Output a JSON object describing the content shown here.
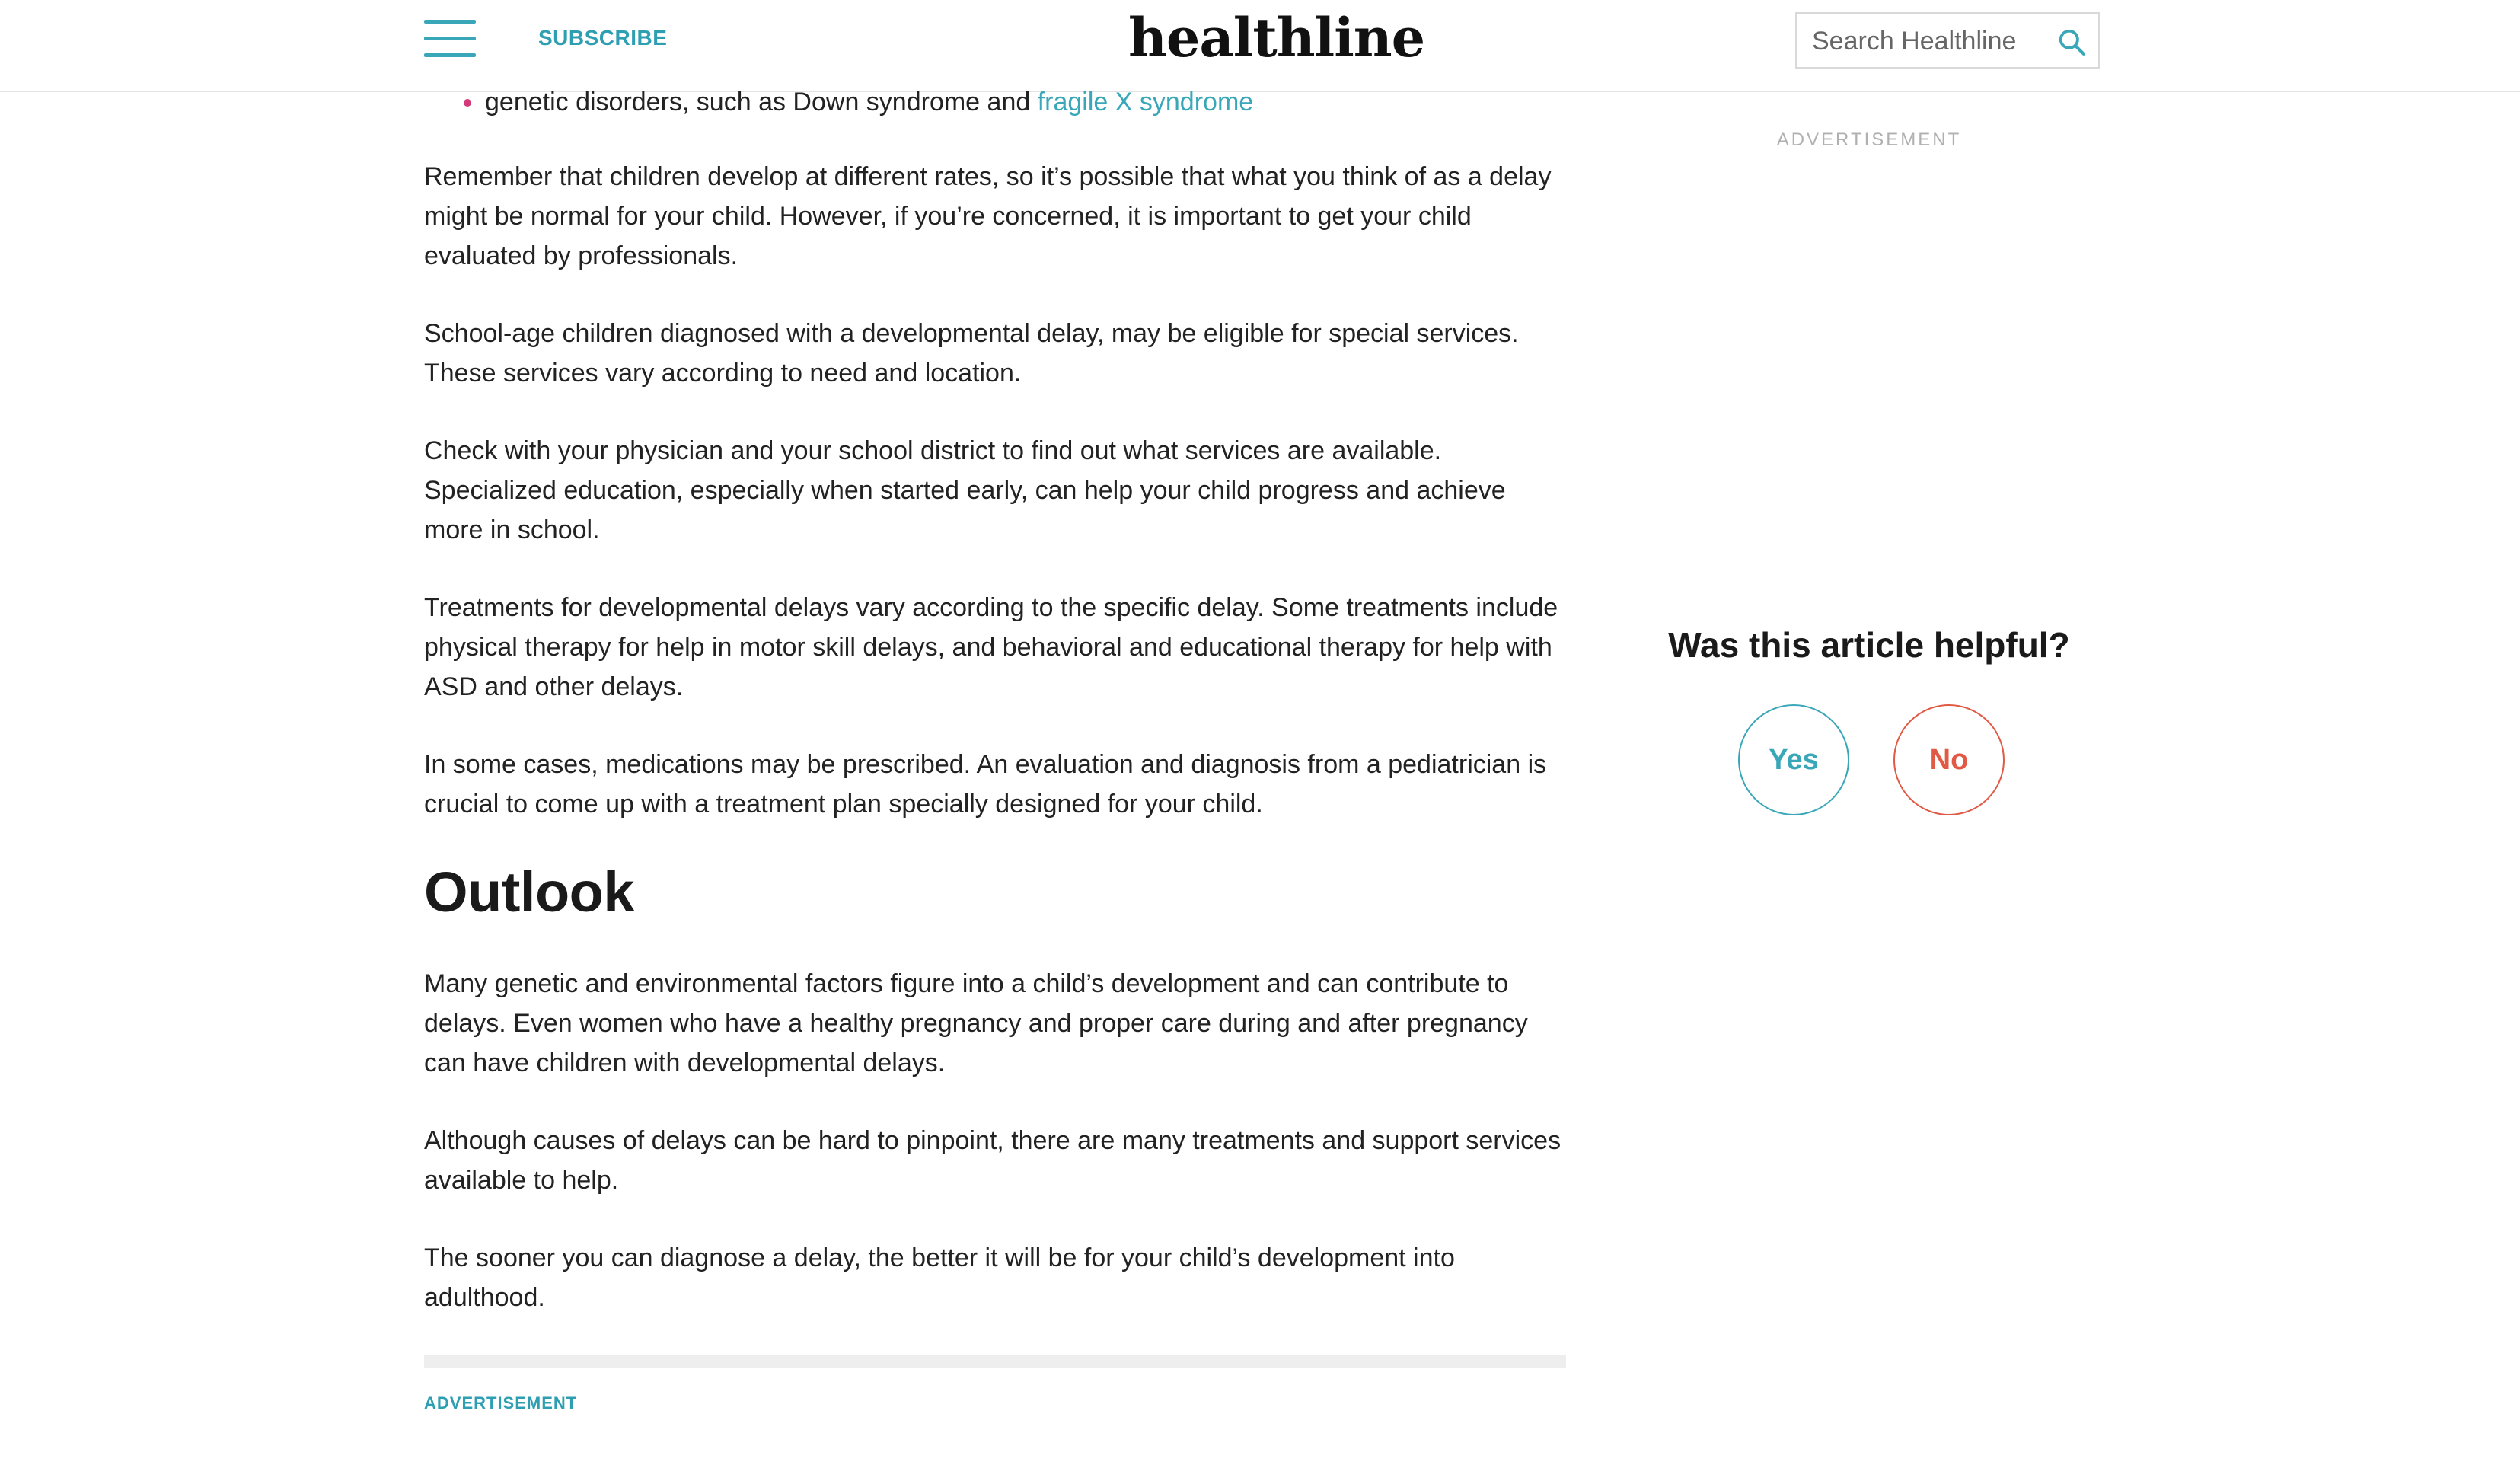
{
  "header": {
    "subscribe_label": "SUBSCRIBE",
    "logo_text": "healthline",
    "search_placeholder": "Search Healthline"
  },
  "article": {
    "bullet": {
      "text": "genetic disorders, such as Down syndrome and ",
      "link_text": "fragile X syndrome"
    },
    "paragraphs_before": [
      "Remember that children develop at different rates, so it’s possible that what you think of as a delay might be normal for your child. However, if you’re concerned, it is important to get your child evaluated by professionals.",
      "School-age children diagnosed with a developmental delay, may be eligible for special services. These services vary according to need and location.",
      "Check with your physician and your school district to find out what services are available. Specialized education, especially when started early, can help your child progress and achieve more in school.",
      "Treatments for developmental delays vary according to the specific delay. Some treatments include physical therapy for help in motor skill delays, and behavioral and educational therapy for help with ASD and other delays.",
      "In some cases, medications may be prescribed. An evaluation and diagnosis from a pediatrician is crucial to come up with a treatment plan specially designed for your child."
    ],
    "section_heading": "Outlook",
    "paragraphs_after": [
      "Many genetic and environmental factors figure into a child’s development and can contribute to delays. Even women who have a healthy pregnancy and proper care during and after pregnancy can have children with developmental delays.",
      "Although causes of delays can be hard to pinpoint, there are many treatments and support services available to help.",
      "The sooner you can diagnose a delay, the better it will be for your child’s development into adulthood."
    ],
    "ad_label": "ADVERTISEMENT"
  },
  "sidebar": {
    "ad_label": "ADVERTISEMENT",
    "feedback_title": "Was this article helpful?",
    "yes_label": "Yes",
    "no_label": "No"
  },
  "colors": {
    "accent": "#3aa7b8",
    "bullet": "#d23a7a",
    "no": "#e05a45"
  }
}
